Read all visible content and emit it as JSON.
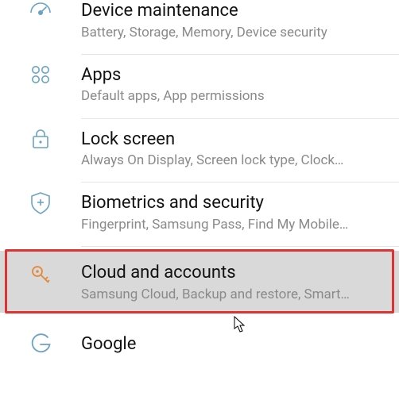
{
  "settings": [
    {
      "icon": "gauge-icon",
      "title": "Device maintenance",
      "subtitle": "Battery, Storage, Memory, Device security"
    },
    {
      "icon": "apps-grid-icon",
      "title": "Apps",
      "subtitle": "Default apps, App permissions"
    },
    {
      "icon": "lock-icon",
      "title": "Lock screen",
      "subtitle": "Always On Display, Screen lock type, Clock…"
    },
    {
      "icon": "shield-plus-icon",
      "title": "Biometrics and security",
      "subtitle": "Fingerprint, Samsung Pass, Find My Mobile…"
    },
    {
      "icon": "key-icon",
      "title": "Cloud and accounts",
      "subtitle": "Samsung Cloud, Backup and restore, Smart…",
      "highlighted": true
    },
    {
      "icon": "google-g-icon",
      "title": "Google",
      "subtitle": ""
    }
  ],
  "ui": {
    "highlight_color": "#d33",
    "cursor_visible": true
  }
}
